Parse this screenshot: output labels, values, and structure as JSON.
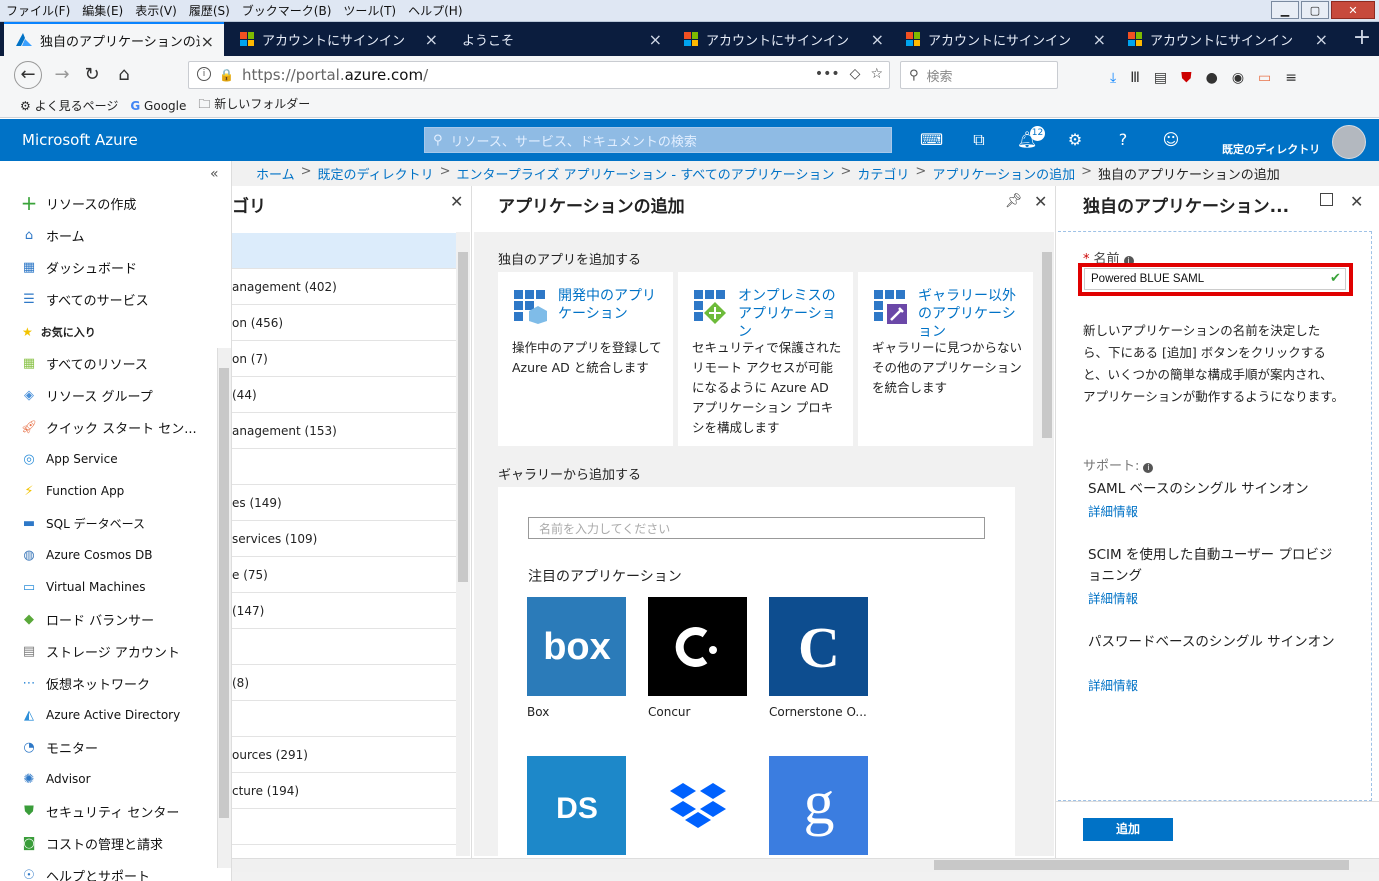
{
  "browser": {
    "menu": [
      "ファイル(F)",
      "編集(E)",
      "表示(V)",
      "履歴(S)",
      "ブックマーク(B)",
      "ツール(T)",
      "ヘルプ(H)"
    ],
    "tabs": [
      {
        "label": "独自のアプリケーションの追加",
        "icon": "azure"
      },
      {
        "label": "アカウントにサインイン",
        "icon": "microsoft"
      },
      {
        "label": "ようこそ",
        "icon": "none"
      },
      {
        "label": "アカウントにサインイン",
        "icon": "microsoft"
      },
      {
        "label": "アカウントにサインイン",
        "icon": "microsoft"
      },
      {
        "label": "アカウントにサインイン",
        "icon": "microsoft"
      }
    ],
    "url_prefix": "https://portal.",
    "url_domain": "azure.com",
    "url_suffix": "/",
    "search_placeholder": "検索",
    "bookmarks": [
      "よく見るページ",
      "Google",
      "新しいフォルダー"
    ]
  },
  "azure": {
    "brand": "Microsoft Azure",
    "search_placeholder": "リソース、サービス、ドキュメントの検索",
    "notification_count": "12",
    "directory": "既定のディレクトリ"
  },
  "breadcrumb": [
    "ホーム",
    "既定のディレクトリ",
    "エンタープライズ アプリケーション - すべてのアプリケーション",
    "カテゴリ",
    "アプリケーションの追加"
  ],
  "breadcrumb_current": "独自のアプリケーションの追加",
  "sidebar": {
    "create_resource": "リソースの作成",
    "home": "ホーム",
    "dashboard": "ダッシュボード",
    "all_services": "すべてのサービス",
    "favorites_label": "お気に入り",
    "items": [
      {
        "label": "すべてのリソース",
        "icon": "grid-icon",
        "color": "#8bc34a"
      },
      {
        "label": "リソース グループ",
        "icon": "cube-icon",
        "color": "#4a90d9"
      },
      {
        "label": "クイック スタート セン...",
        "icon": "rocket-icon",
        "color": "#e8734a"
      },
      {
        "label": "App Service",
        "icon": "globe-icon",
        "color": "#2e8fd9"
      },
      {
        "label": "Function App",
        "icon": "bolt-icon",
        "color": "#f2c300"
      },
      {
        "label": "SQL データベース",
        "icon": "sql-icon",
        "color": "#2e78c7"
      },
      {
        "label": "Azure Cosmos DB",
        "icon": "planet-icon",
        "color": "#3a76b8"
      },
      {
        "label": "Virtual Machines",
        "icon": "monitor-icon",
        "color": "#2e8fd9"
      },
      {
        "label": "ロード バランサー",
        "icon": "diamond-icon",
        "color": "#5aa83a"
      },
      {
        "label": "ストレージ アカウント",
        "icon": "table-icon",
        "color": "#7a7a7a"
      },
      {
        "label": "仮想ネットワーク",
        "icon": "network-icon",
        "color": "#3a8fd9"
      },
      {
        "label": "Azure Active Directory",
        "icon": "pyramid-icon",
        "color": "#2e8fd9"
      },
      {
        "label": "モニター",
        "icon": "gauge-icon",
        "color": "#2e78c7"
      },
      {
        "label": "Advisor",
        "icon": "advisor-icon",
        "color": "#2e78c7"
      },
      {
        "label": "セキュリティ センター",
        "icon": "shield-icon",
        "color": "#3a9d3a"
      },
      {
        "label": "コストの管理と請求",
        "icon": "cost-icon",
        "color": "#3a9d3a"
      },
      {
        "label": "ヘルプとサポート",
        "icon": "help-icon",
        "color": "#2e78c7"
      }
    ]
  },
  "category_blade": {
    "title": "ゴリ",
    "rows": [
      "",
      "anagement (402)",
      "on (456)",
      "on (7)",
      "(44)",
      "anagement (153)",
      "",
      "es (149)",
      "services (109)",
      "e (75)",
      "(147)",
      "",
      "(8)",
      "",
      "ources (291)",
      "cture (194)",
      ""
    ]
  },
  "add_blade": {
    "title": "アプリケーションの追加",
    "own_heading": "独自のアプリを追加する",
    "cards": [
      {
        "title": "開発中のアプリケーション",
        "desc": "操作中のアプリを登録して Azure AD と統合します"
      },
      {
        "title": "オンプレミスのアプリケーション",
        "desc": "セキュリティで保護されたリモート アクセスが可能になるように Azure AD アプリケーション プロキシを構成します"
      },
      {
        "title": "ギャラリー以外のアプリケーション",
        "desc": "ギャラリーに見つからないその他のアプリケーションを統合します"
      }
    ],
    "gallery_heading": "ギャラリーから追加する",
    "gallery_search_placeholder": "名前を入力してください",
    "featured_heading": "注目のアプリケーション",
    "apps": [
      {
        "name": "Box",
        "bg": "#2b7bb9"
      },
      {
        "name": "Concur",
        "bg": "#000000"
      },
      {
        "name": "Cornerstone O...",
        "bg": "#0d4d8f"
      },
      {
        "name": "",
        "bg": "#1d88c9"
      },
      {
        "name": "",
        "bg": "#ffffff"
      },
      {
        "name": "",
        "bg": "#3b7de0"
      }
    ]
  },
  "right_blade": {
    "title": "独自のアプリケーション...",
    "name_label": "名前",
    "name_value": "Powered BLUE SAML",
    "description": "新しいアプリケーションの名前を決定したら、下にある [追加] ボタンをクリックすると、いくつかの簡単な構成手順が案内され、アプリケーションが動作するようになります。",
    "support_label": "サポート:",
    "support_items": [
      {
        "label": "SAML ベースのシングル サインオン",
        "link": "詳細情報"
      },
      {
        "label": "SCIM を使用した自動ユーザー プロビジョニング",
        "link": "詳細情報"
      },
      {
        "label": "パスワードベースのシングル サインオン",
        "link": "詳細情報"
      }
    ],
    "add_button": "追加"
  }
}
